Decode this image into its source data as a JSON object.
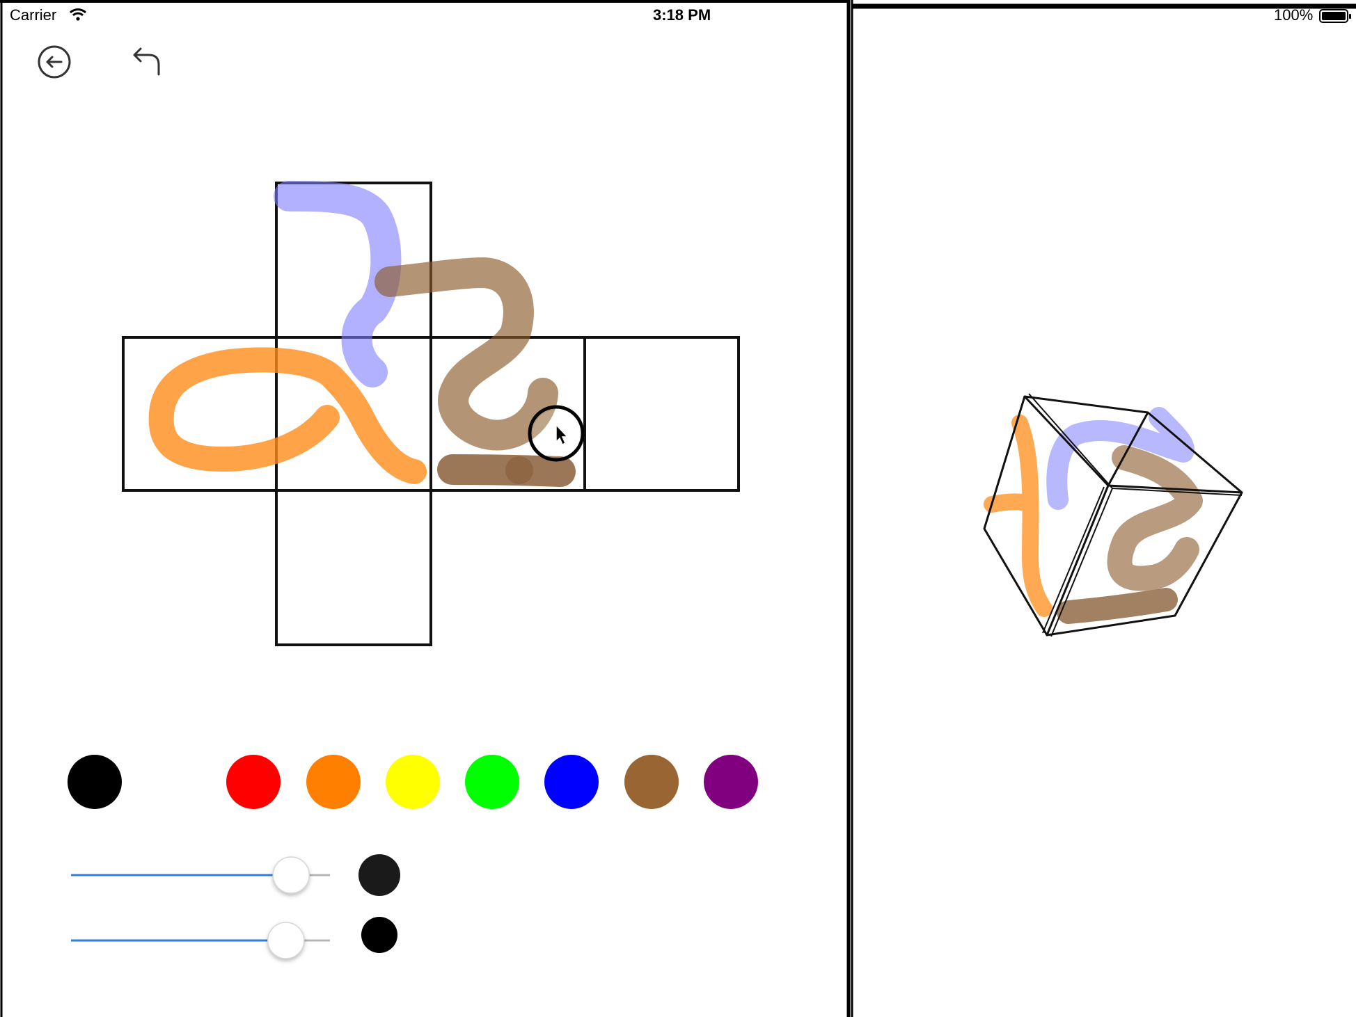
{
  "status_bar": {
    "carrier": "Carrier",
    "time": "3:18 PM",
    "battery": "100%"
  },
  "toolbar": {
    "back_icon": "back-arrow-circle-icon",
    "undo_icon": "undo-arrow-icon"
  },
  "palette": {
    "colors": [
      {
        "name": "black",
        "hex": "#000000"
      },
      {
        "name": "white",
        "hex": "#ffffff"
      },
      {
        "name": "red",
        "hex": "#ff0000"
      },
      {
        "name": "orange",
        "hex": "#ff8000"
      },
      {
        "name": "yellow",
        "hex": "#ffff00"
      },
      {
        "name": "green",
        "hex": "#00ff00"
      },
      {
        "name": "blue",
        "hex": "#0000ff"
      },
      {
        "name": "brown",
        "hex": "#996633"
      },
      {
        "name": "purple",
        "hex": "#800080"
      }
    ]
  },
  "sliders": {
    "brush_opacity": {
      "value": 0.85,
      "preview_color": "#1a1a1a"
    },
    "brush_size": {
      "value": 0.83,
      "preview_color": "#000000"
    }
  },
  "colors": {
    "accent": "#2f7fd6",
    "stroke_blue": "#8a8aff",
    "stroke_brown": "#8b5a2b",
    "stroke_orange": "#ff8c1a"
  }
}
